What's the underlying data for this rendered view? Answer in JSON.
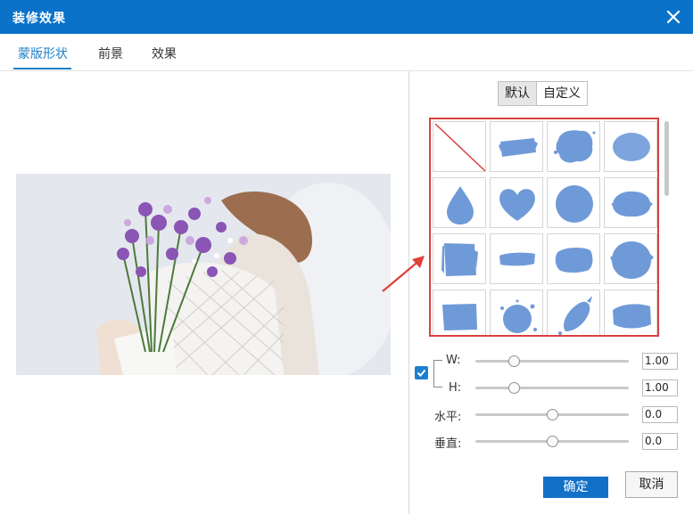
{
  "window": {
    "title": "装修效果"
  },
  "tabs": [
    {
      "label": "蒙版形状"
    },
    {
      "label": "前景"
    },
    {
      "label": "效果"
    }
  ],
  "mode_toggle": {
    "default_label": "默认",
    "custom_label": "自定义",
    "selected": "默认"
  },
  "mask_shapes": [
    "none",
    "brush-stroke",
    "splatter",
    "ellipse",
    "drop",
    "heart",
    "circle",
    "rough-ellipse",
    "rough-square",
    "brush-streak",
    "rough-blob",
    "rough-circle",
    "rough-rect",
    "splatter-circle",
    "ink-splash",
    "brush-stroke-2"
  ],
  "shape_color": "#6f9ad8",
  "highlight_color": "#d9403f",
  "accent_color": "#0a72c9",
  "sliders": {
    "lock_checked": true,
    "w": {
      "label": "W:",
      "value": "1.00",
      "fraction": 0.25
    },
    "h": {
      "label": "H:",
      "value": "1.00",
      "fraction": 0.25
    },
    "horizontal": {
      "label": "水平:",
      "value": "0.0",
      "fraction": 0.5
    },
    "vertical": {
      "label": "垂直:",
      "value": "0.0",
      "fraction": 0.5
    }
  },
  "buttons": {
    "ok": "确定",
    "cancel": "取消"
  }
}
